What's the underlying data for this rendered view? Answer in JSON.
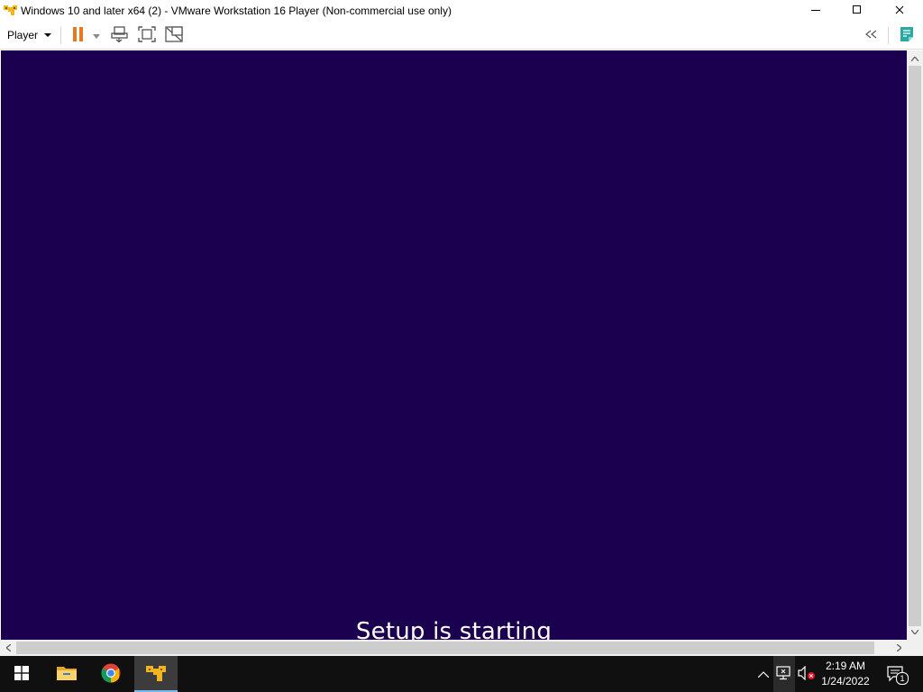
{
  "window": {
    "title": "Windows 10 and later x64 (2) - VMware Workstation 16 Player (Non-commercial use only)",
    "app_icon": "vmware-player-icon",
    "controls": [
      "minimize-icon",
      "maximize-icon",
      "close-icon"
    ]
  },
  "toolbar": {
    "player_label": "Player",
    "tools": [
      "pause-icon",
      "dropdown-caret-icon",
      "send-ctrl-alt-del-icon",
      "full-screen-icon",
      "unity-icon"
    ],
    "right_tools": [
      "collapse-icon",
      "library-icon"
    ]
  },
  "vm": {
    "background": "#1b0050",
    "status_text": "Setup is starting"
  },
  "taskbar": {
    "items": [
      "windows-start-icon",
      "file-explorer-icon",
      "chrome-icon",
      "vmware-player-icon"
    ],
    "active_item": "vmware-player-icon",
    "tray_icons": [
      "show-hidden-icons-chevron-icon",
      "network-icon",
      "volume-muted-icon"
    ],
    "time": "2:19 AM",
    "date": "1/24/2022",
    "notification_count": "1"
  },
  "colors": {
    "accent_orange": "#e87722",
    "vmware_yellow": "#f2b51d",
    "taskbar": "#101010",
    "active_underline": "#76b9ed"
  }
}
